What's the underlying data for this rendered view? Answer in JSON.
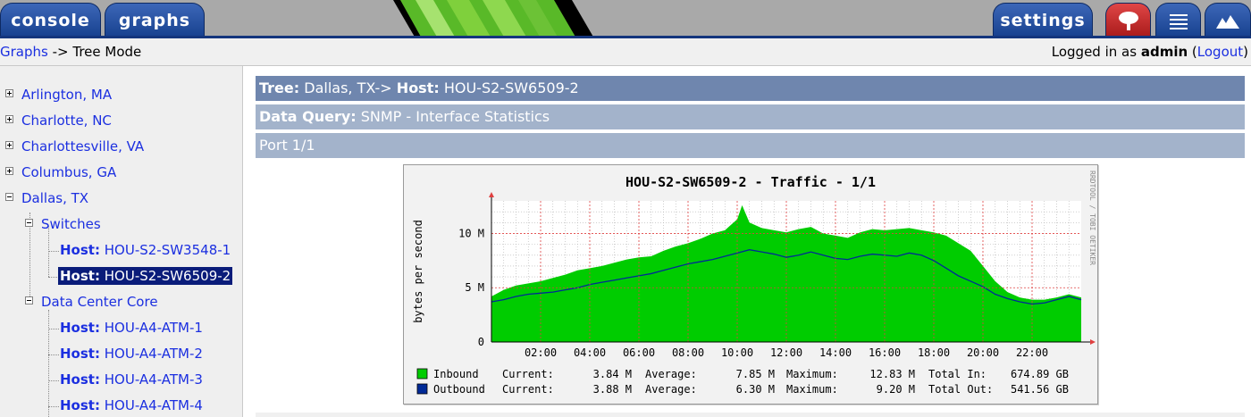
{
  "nav": {
    "tabs": [
      {
        "label": "console"
      },
      {
        "label": "graphs"
      }
    ],
    "settings_label": "settings"
  },
  "breadcrumb": {
    "graphs_link": "Graphs",
    "separator": "->",
    "mode": "Tree Mode"
  },
  "session": {
    "prefix": "Logged in as",
    "user": "admin",
    "logout_label": "Logout",
    "open_paren": "(",
    "close_paren": ")"
  },
  "tree": {
    "host_prefix": "Host:",
    "sites": [
      "Arlington, MA",
      "Charlotte, NC",
      "Charlottesville, VA",
      "Columbus, GA",
      "Dallas, TX"
    ],
    "groups": [
      "Switches",
      "Data Center Core"
    ],
    "switch_hosts": [
      "HOU-S2-SW3548-1",
      "HOU-S2-SW6509-2"
    ],
    "core_hosts": [
      "HOU-A4-ATM-1",
      "HOU-A4-ATM-2",
      "HOU-A4-ATM-3",
      "HOU-A4-ATM-4"
    ]
  },
  "header": {
    "tree_label": "Tree:",
    "tree_value": "Dallas, TX->",
    "host_label": "Host:",
    "host_value": "HOU-S2-SW6509-2",
    "query_label": "Data Query:",
    "query_value": "SNMP - Interface Statistics",
    "port_label": "Port 1/1"
  },
  "colors": {
    "inbound": "#00cc00",
    "outbound": "#002a97",
    "band_dark": "#6f86ae",
    "band_light": "#a3b3cb"
  },
  "chart_data": {
    "type": "area",
    "title": "HOU-S2-SW6509-2 - Traffic - 1/1",
    "ylabel": "bytes per second",
    "watermark": "RRDTOOL / TOBI OETIKER",
    "ylim": [
      0,
      13000000
    ],
    "y_ticks": [
      {
        "value": 0,
        "label": "0"
      },
      {
        "value": 5000000,
        "label": "5 M"
      },
      {
        "value": 10000000,
        "label": "10 M"
      }
    ],
    "xlim": [
      0,
      24
    ],
    "x_ticks": [
      {
        "value": 2,
        "label": "02:00"
      },
      {
        "value": 4,
        "label": "04:00"
      },
      {
        "value": 6,
        "label": "06:00"
      },
      {
        "value": 8,
        "label": "08:00"
      },
      {
        "value": 10,
        "label": "10:00"
      },
      {
        "value": 12,
        "label": "12:00"
      },
      {
        "value": 14,
        "label": "14:00"
      },
      {
        "value": 16,
        "label": "16:00"
      },
      {
        "value": 18,
        "label": "18:00"
      },
      {
        "value": 20,
        "label": "20:00"
      },
      {
        "value": 22,
        "label": "22:00"
      }
    ],
    "series": [
      {
        "name": "Inbound",
        "style": "area",
        "x": [
          0.0,
          0.5,
          1.0,
          1.5,
          2.0,
          2.5,
          3.0,
          3.5,
          4.0,
          4.5,
          5.0,
          5.5,
          6.0,
          6.5,
          7.0,
          7.5,
          8.0,
          8.5,
          9.0,
          9.5,
          10.0,
          10.2,
          10.5,
          11.0,
          11.5,
          12.0,
          12.5,
          13.0,
          13.5,
          14.0,
          14.5,
          15.0,
          15.5,
          16.0,
          16.5,
          17.0,
          17.5,
          18.0,
          18.5,
          19.0,
          19.5,
          20.0,
          20.5,
          21.0,
          21.5,
          22.0,
          22.5,
          23.0,
          23.5,
          24.0
        ],
        "y": [
          4.2,
          4.8,
          5.2,
          5.4,
          5.6,
          5.9,
          6.2,
          6.6,
          6.8,
          7.0,
          7.3,
          7.6,
          7.8,
          7.9,
          8.4,
          8.8,
          9.1,
          9.5,
          10.0,
          10.3,
          11.3,
          12.6,
          11.0,
          10.5,
          10.3,
          10.1,
          10.4,
          10.6,
          10.0,
          9.8,
          9.6,
          10.1,
          10.4,
          10.3,
          10.4,
          10.5,
          10.3,
          10.1,
          9.8,
          9.1,
          8.4,
          7.0,
          5.6,
          4.6,
          4.1,
          3.9,
          3.9,
          4.1,
          4.4,
          4.1
        ]
      },
      {
        "name": "Outbound",
        "style": "line",
        "x": [
          0.0,
          0.5,
          1.0,
          1.5,
          2.0,
          2.5,
          3.0,
          3.5,
          4.0,
          4.5,
          5.0,
          5.5,
          6.0,
          6.5,
          7.0,
          7.5,
          8.0,
          8.5,
          9.0,
          9.5,
          10.0,
          10.5,
          11.0,
          11.5,
          12.0,
          12.5,
          13.0,
          13.5,
          14.0,
          14.5,
          15.0,
          15.5,
          16.0,
          16.5,
          17.0,
          17.5,
          18.0,
          18.5,
          19.0,
          19.5,
          20.0,
          20.5,
          21.0,
          21.5,
          22.0,
          22.5,
          23.0,
          23.5,
          24.0
        ],
        "y": [
          3.7,
          3.9,
          4.2,
          4.4,
          4.5,
          4.6,
          4.8,
          5.0,
          5.3,
          5.5,
          5.7,
          5.9,
          6.1,
          6.3,
          6.6,
          6.9,
          7.2,
          7.4,
          7.6,
          7.9,
          8.2,
          8.5,
          8.3,
          8.1,
          7.8,
          8.0,
          8.3,
          8.0,
          7.7,
          7.6,
          7.9,
          8.1,
          8.0,
          7.9,
          8.2,
          8.0,
          7.5,
          6.8,
          6.1,
          5.6,
          5.1,
          4.4,
          4.0,
          3.7,
          3.5,
          3.6,
          3.9,
          4.2,
          3.9
        ]
      }
    ],
    "y_scale_note": "series y values in millions of bytes per second",
    "legend": {
      "position": "bottom",
      "stat_labels": [
        "Current:",
        "Average:",
        "Maximum:"
      ],
      "total_in_label": "Total In:",
      "total_out_label": "Total Out:",
      "rows": [
        {
          "name": "Inbound",
          "current": "3.84 M",
          "average": "7.85 M",
          "maximum": "12.83 M",
          "total": "674.89 GB"
        },
        {
          "name": "Outbound",
          "current": "3.88 M",
          "average": "6.30 M",
          "maximum": "9.20 M",
          "total": "541.56 GB"
        }
      ]
    }
  }
}
